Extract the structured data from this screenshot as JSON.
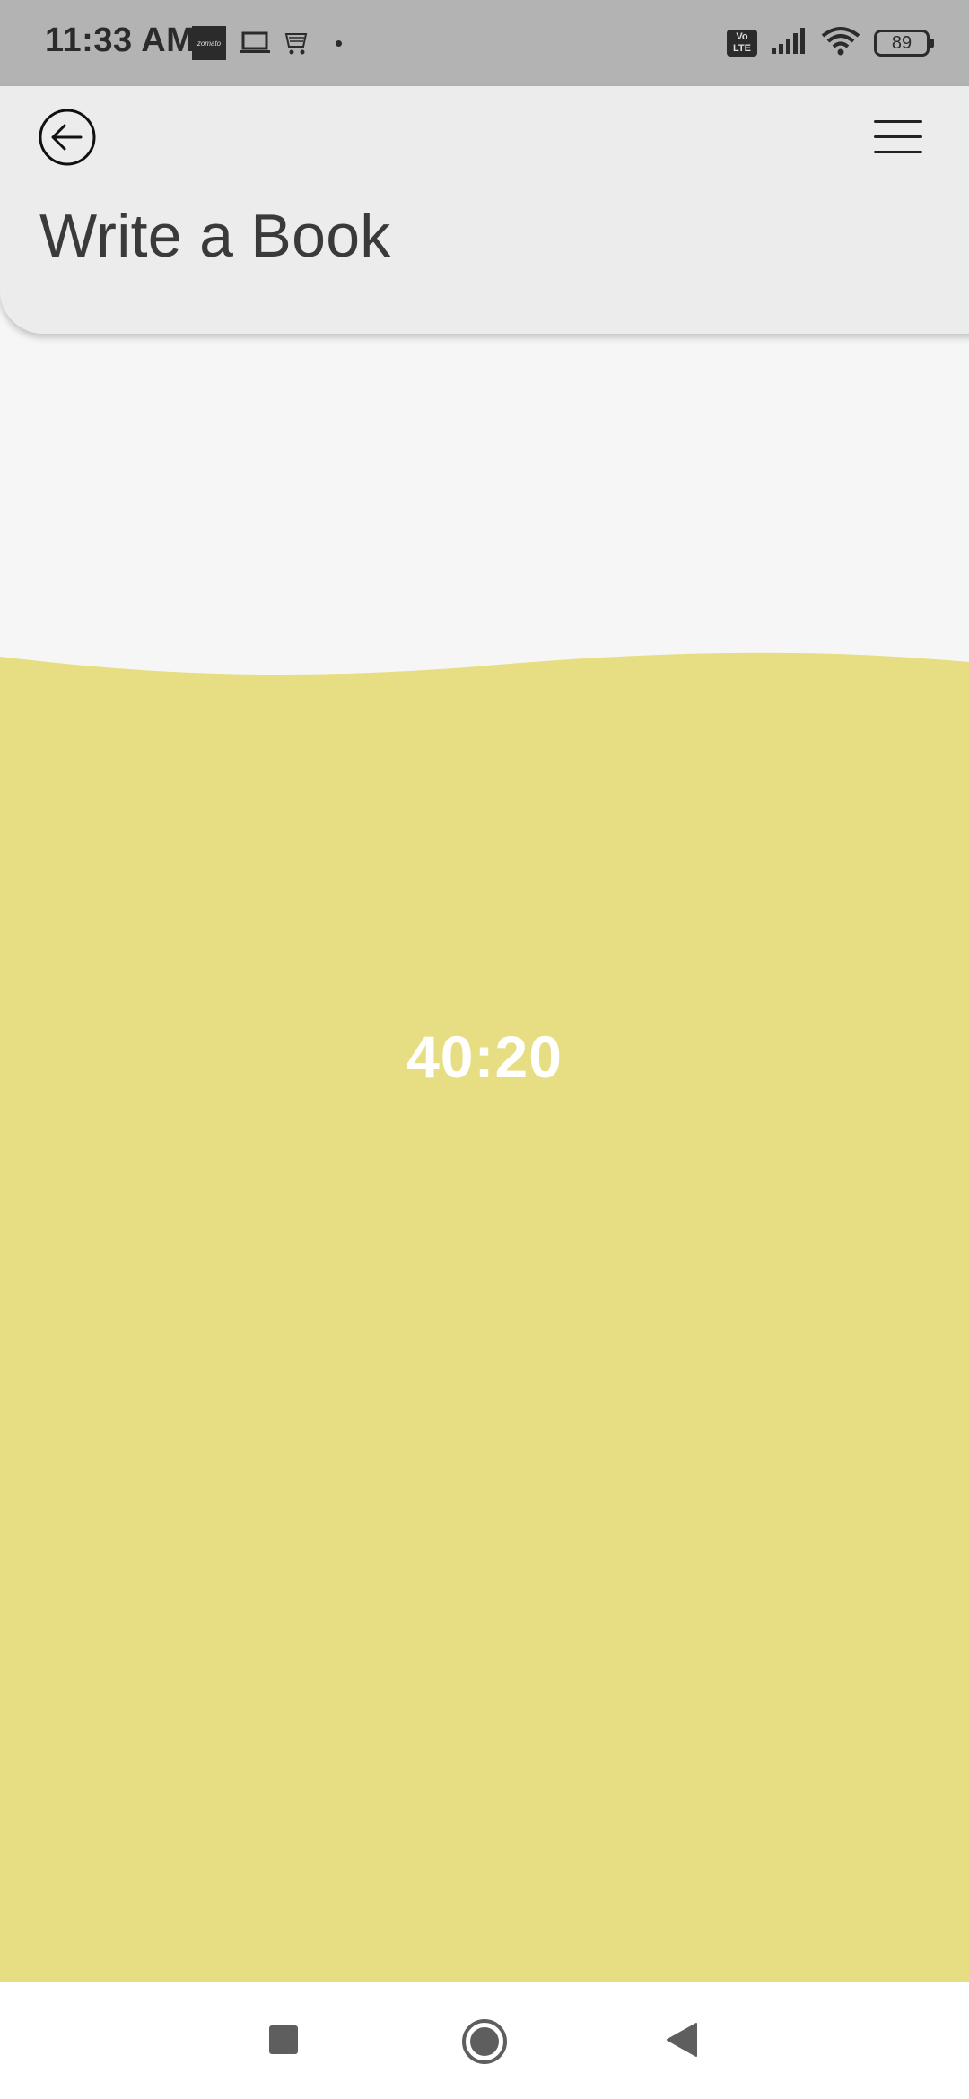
{
  "status_bar": {
    "time": "11:33 AM",
    "notification_icons": [
      "zomato-icon",
      "laptop-icon",
      "amazon-icon",
      "dot-icon"
    ],
    "zomato_label": "zomato",
    "volte_top": "Vo",
    "volte_bottom": "LTE",
    "battery_level": "89"
  },
  "header": {
    "title": "Write a Book",
    "background": "#ececec"
  },
  "timer": {
    "display": "40:20",
    "fill_color": "#e7de84"
  },
  "nav_bar": {
    "icons": [
      "recents-icon",
      "home-icon",
      "back-icon"
    ]
  }
}
